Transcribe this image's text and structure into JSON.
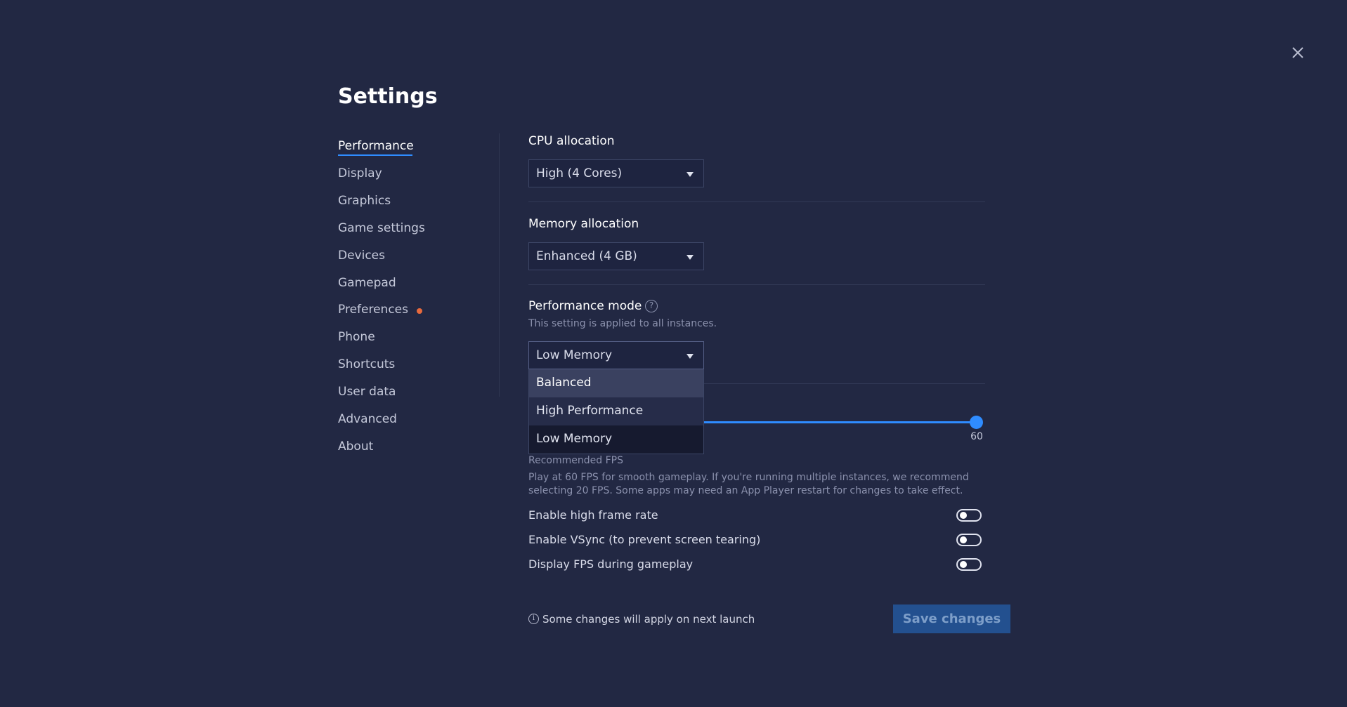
{
  "window": {
    "title": "Settings",
    "close_icon": "close-icon"
  },
  "sidebar": {
    "items": [
      {
        "label": "Performance",
        "active": true
      },
      {
        "label": "Display"
      },
      {
        "label": "Graphics"
      },
      {
        "label": "Game settings"
      },
      {
        "label": "Devices"
      },
      {
        "label": "Gamepad"
      },
      {
        "label": "Preferences",
        "notification_dot": true
      },
      {
        "label": "Phone"
      },
      {
        "label": "Shortcuts"
      },
      {
        "label": "User data"
      },
      {
        "label": "Advanced"
      },
      {
        "label": "About"
      }
    ]
  },
  "cpu": {
    "label": "CPU allocation",
    "value": "High (4 Cores)"
  },
  "memory": {
    "label": "Memory allocation",
    "value": "Enhanced (4 GB)"
  },
  "perf_mode": {
    "label": "Performance mode",
    "help_icon": "help-icon",
    "note": "This setting is applied to all instances.",
    "value": "Low Memory",
    "options": [
      "Balanced",
      "High Performance",
      "Low Memory"
    ]
  },
  "fps": {
    "slider_value": "60",
    "recommended_label": "Recommended FPS",
    "description": "Play at 60 FPS for smooth gameplay. If you're running multiple instances, we recommend selecting 20 FPS. Some apps may need an App Player restart for changes to take effect."
  },
  "toggles": [
    {
      "label": "Enable high frame rate",
      "on": false
    },
    {
      "label": "Enable VSync (to prevent screen tearing)",
      "on": false
    },
    {
      "label": "Display FPS during gameplay",
      "on": false
    }
  ],
  "footer": {
    "info_icon": "info-icon",
    "notice": "Some changes will apply on next launch",
    "save_label": "Save changes"
  },
  "colors": {
    "background": "#222843",
    "accent": "#2f8cff",
    "notification_dot": "#e86a3d",
    "save_button": "#23508f"
  }
}
